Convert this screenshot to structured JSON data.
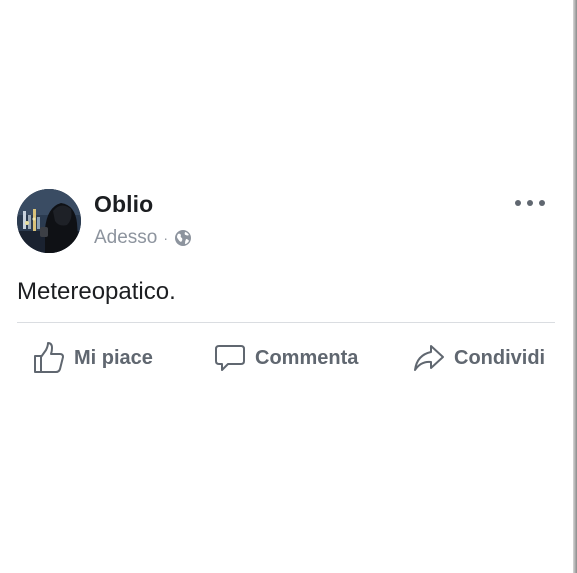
{
  "post": {
    "author": "Oblio",
    "timestamp": "Adesso",
    "separator": "·",
    "privacy_icon": "globe-icon",
    "text": "Metereopatico.",
    "more_icon": "more-horizontal-icon"
  },
  "actions": {
    "like_label": "Mi piace",
    "comment_label": "Commenta",
    "share_label": "Condividi"
  },
  "colors": {
    "primary_text": "#1c1e21",
    "secondary_text": "#8d949e",
    "action_text": "#606770",
    "divider": "#dadde1",
    "background": "#ffffff"
  }
}
